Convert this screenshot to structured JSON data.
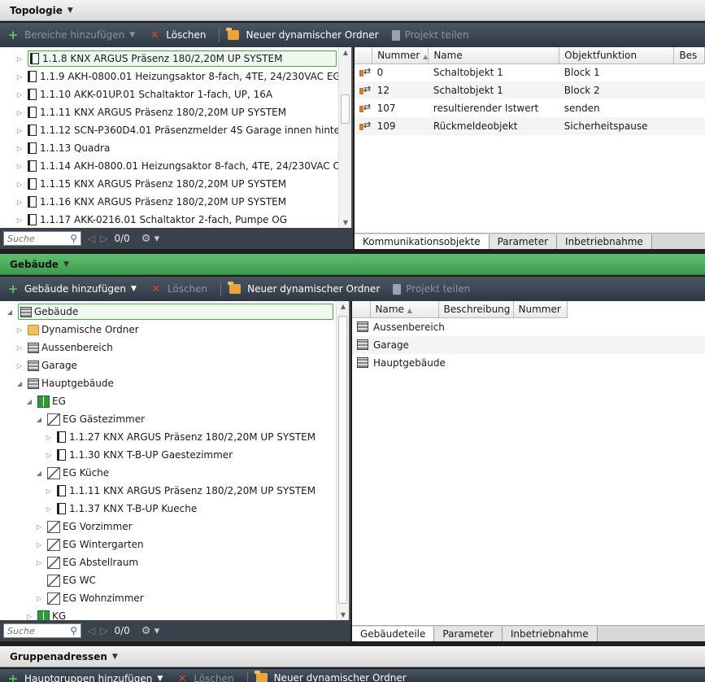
{
  "topology": {
    "header": "Topologie",
    "toolbar": {
      "add_label": "Bereiche hinzufügen",
      "delete_label": "Löschen",
      "dyn_folder_label": "Neuer dynamischer Ordner",
      "share_label": "Projekt teilen"
    },
    "tree": [
      {
        "label": "1.1.8  KNX ARGUS Präsenz 180/2,20M UP SYSTEM"
      },
      {
        "label": "1.1.9  AKH-0800.01 Heizungsaktor 8-fach, 4TE, 24/230VAC EG"
      },
      {
        "label": "1.1.10  AKK-01UP.01 Schaltaktor 1-fach, UP, 16A"
      },
      {
        "label": "1.1.11  KNX ARGUS Präsenz 180/2,20M UP SYSTEM"
      },
      {
        "label": "1.1.12  SCN-P360D4.01 Präsenzmelder 4S Garage innen hinten"
      },
      {
        "label": "1.1.13  Quadra"
      },
      {
        "label": "1.1.14  AKH-0800.01 Heizungsaktor 8-fach, 4TE, 24/230VAC OG"
      },
      {
        "label": "1.1.15  KNX ARGUS Präsenz 180/2,20M UP SYSTEM"
      },
      {
        "label": "1.1.16  KNX ARGUS Präsenz 180/2,20M UP SYSTEM"
      },
      {
        "label": "1.1.17  AKK-0216.01 Schaltaktor 2-fach, Pumpe OG"
      }
    ],
    "search_placeholder": "Suche",
    "count": "0/0",
    "columns": [
      "Nummer",
      "Name",
      "Objektfunktion",
      "Bes"
    ],
    "rows": [
      {
        "nummer": "0",
        "name": "Schaltobjekt 1",
        "funktion": "Block 1"
      },
      {
        "nummer": "12",
        "name": "Schaltobjekt 1",
        "funktion": "Block 2"
      },
      {
        "nummer": "107",
        "name": "resultierender Istwert",
        "funktion": "senden"
      },
      {
        "nummer": "109",
        "name": "Rückmeldeobjekt",
        "funktion": "Sicherheitspause"
      }
    ],
    "tabs": [
      "Kommunikationsobjekte",
      "Parameter",
      "Inbetriebnahme"
    ]
  },
  "building": {
    "header": "Gebäude",
    "toolbar": {
      "add_label": "Gebäude hinzufügen",
      "delete_label": "Löschen",
      "dyn_folder_label": "Neuer dynamischer Ordner",
      "share_label": "Projekt teilen"
    },
    "tree": [
      {
        "label": "Gebäude",
        "icon": "bld",
        "level": 0,
        "exp": "◢"
      },
      {
        "label": "Dynamische Ordner",
        "icon": "dyn",
        "level": 1,
        "exp": "▷"
      },
      {
        "label": "Aussenbereich",
        "icon": "bld",
        "level": 1,
        "exp": "▷"
      },
      {
        "label": "Garage",
        "icon": "bld",
        "level": 1,
        "exp": "▷"
      },
      {
        "label": "Hauptgebäude",
        "icon": "bld",
        "level": 1,
        "exp": "◢"
      },
      {
        "label": "EG",
        "icon": "floor",
        "level": 2,
        "exp": "◢"
      },
      {
        "label": "EG  Gästezimmer",
        "icon": "room",
        "level": 3,
        "exp": "◢"
      },
      {
        "label": "1.1.27  KNX ARGUS Präsenz 180/2,20M UP SYSTEM",
        "icon": "dev",
        "level": 4,
        "exp": "▷"
      },
      {
        "label": "1.1.30  KNX T-B-UP Gaestezimmer",
        "icon": "dev",
        "level": 4,
        "exp": "▷"
      },
      {
        "label": "EG  Küche",
        "icon": "room",
        "level": 3,
        "exp": "◢"
      },
      {
        "label": "1.1.11  KNX ARGUS Präsenz 180/2,20M UP SYSTEM",
        "icon": "dev",
        "level": 4,
        "exp": "▷"
      },
      {
        "label": "1.1.37  KNX T-B-UP Kueche",
        "icon": "dev",
        "level": 4,
        "exp": "▷"
      },
      {
        "label": "EG  Vorzimmer",
        "icon": "room",
        "level": 3,
        "exp": "▷"
      },
      {
        "label": "EG  Wintergarten",
        "icon": "room",
        "level": 3,
        "exp": "▷"
      },
      {
        "label": "EG Abstellraum",
        "icon": "room",
        "level": 3,
        "exp": "▷"
      },
      {
        "label": "EG WC",
        "icon": "room",
        "level": 3,
        "exp": ""
      },
      {
        "label": "EG Wohnzimmer",
        "icon": "room",
        "level": 3,
        "exp": "▷"
      },
      {
        "label": "KG",
        "icon": "floor",
        "level": 2,
        "exp": "▷"
      }
    ],
    "search_placeholder": "Suche",
    "count": "0/0",
    "columns": [
      "Name",
      "Beschreibung",
      "Nummer"
    ],
    "rows": [
      {
        "name": "Aussenbereich"
      },
      {
        "name": "Garage"
      },
      {
        "name": "Hauptgebäude"
      }
    ],
    "tabs": [
      "Gebäudeteile",
      "Parameter",
      "Inbetriebnahme"
    ]
  },
  "group": {
    "header": "Gruppenadressen",
    "toolbar": {
      "add_label": "Hauptgruppen hinzufügen",
      "delete_label": "Löschen",
      "dyn_folder_label": "Neuer dynamischer Ordner"
    }
  }
}
